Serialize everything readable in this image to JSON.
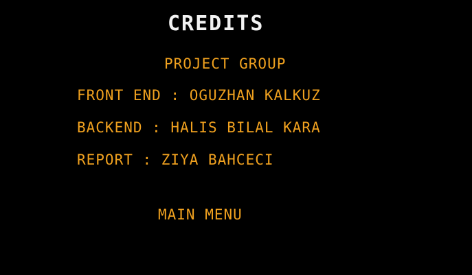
{
  "screen": {
    "title": "CREDITS",
    "section_title": "PROJECT GROUP",
    "credits": [
      {
        "text": "FRONT END : OGUZHAN KALKUZ"
      },
      {
        "text": "BACKEND : HALIS BILAL KARA"
      },
      {
        "text": "REPORT : ZIYA BAHCECI"
      }
    ],
    "menu_button_label": "MAIN MENU"
  },
  "colors": {
    "background": "#000000",
    "title": "#f2f2f2",
    "accent": "#f0a11f"
  }
}
